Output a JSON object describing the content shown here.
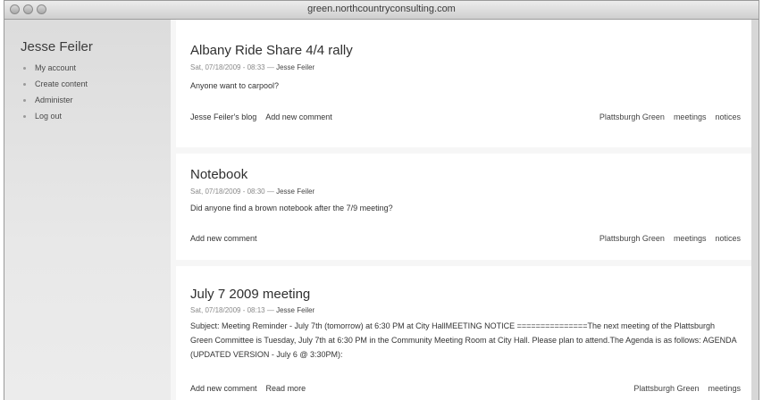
{
  "window": {
    "title": "green.northcountryconsulting.com"
  },
  "sidebar": {
    "username": "Jesse Feiler",
    "items": [
      {
        "label": "My account"
      },
      {
        "label": "Create content"
      },
      {
        "label": "Administer"
      },
      {
        "label": "Log out"
      }
    ]
  },
  "nodes": [
    {
      "title": "Albany Ride Share 4/4 rally",
      "date": "Sat, 07/18/2009 - 08:33 —",
      "author": "Jesse Feiler",
      "body": "Anyone want to carpool?",
      "links": [
        "Jesse Feiler's blog",
        "Add new comment"
      ],
      "tags": [
        "Plattsburgh Green",
        "meetings",
        "notices"
      ]
    },
    {
      "title": "Notebook",
      "date": "Sat, 07/18/2009 - 08:30 —",
      "author": "Jesse Feiler",
      "body": "Did anyone find a brown notebook after the 7/9 meeting?",
      "links": [
        "Add new comment"
      ],
      "tags": [
        "Plattsburgh Green",
        "meetings",
        "notices"
      ]
    },
    {
      "title": "July 7 2009 meeting",
      "date": "Sat, 07/18/2009 - 08:13 —",
      "author": "Jesse Feiler",
      "body": "Subject: Meeting Reminder - July 7th (tomorrow) at 6:30 PM at City HallMEETING NOTICE ===============The next meeting of the Plattsburgh Green Committee is Tuesday, July 7th at 6:30 PM in the Community Meeting Room at City Hall. Please plan to attend.The Agenda is as follows: AGENDA (UPDATED VERSION - July 6 @ 3:30PM):",
      "links": [
        "Add new comment",
        "Read more"
      ],
      "tags": [
        "Plattsburgh Green",
        "meetings"
      ]
    }
  ]
}
